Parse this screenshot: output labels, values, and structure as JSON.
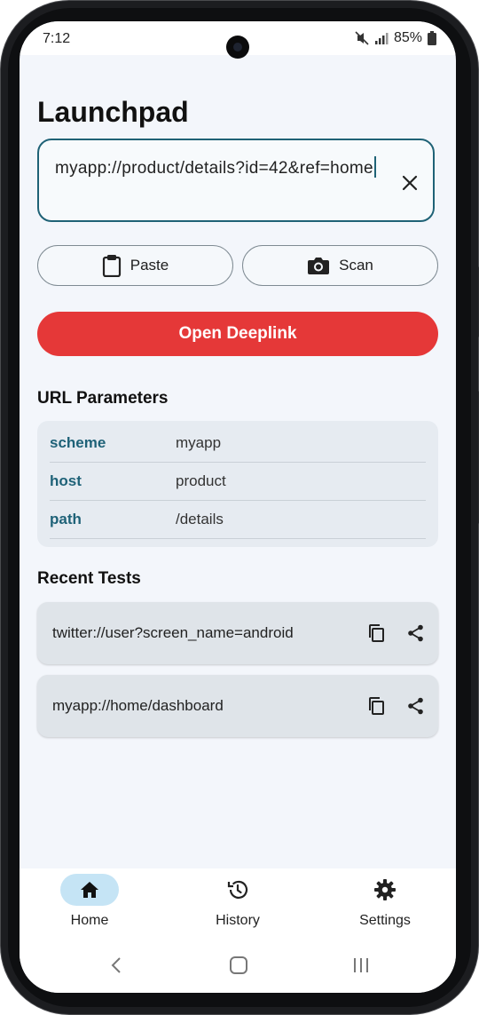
{
  "status": {
    "time": "7:12",
    "battery": "85%"
  },
  "app": {
    "title": "Launchpad"
  },
  "url_input": {
    "value": "myapp://product/details?id=42&ref=home"
  },
  "actions": {
    "paste_label": "Paste",
    "scan_label": "Scan",
    "open_label": "Open Deeplink"
  },
  "params": {
    "title": "URL Parameters",
    "rows": [
      {
        "key": "scheme",
        "value": "myapp"
      },
      {
        "key": "host",
        "value": "product"
      },
      {
        "key": "path",
        "value": "/details"
      }
    ]
  },
  "recent": {
    "title": "Recent Tests",
    "items": [
      {
        "url": "twitter://user?screen_name=android"
      },
      {
        "url": "myapp://home/dashboard"
      }
    ]
  },
  "nav": {
    "items": [
      {
        "label": "Home",
        "icon": "home-icon",
        "active": true
      },
      {
        "label": "History",
        "icon": "history-icon",
        "active": false
      },
      {
        "label": "Settings",
        "icon": "gear-icon",
        "active": false
      }
    ]
  },
  "colors": {
    "accent": "#1f6276",
    "danger": "#e53838",
    "nav_active_bg": "#c5e4f5"
  }
}
